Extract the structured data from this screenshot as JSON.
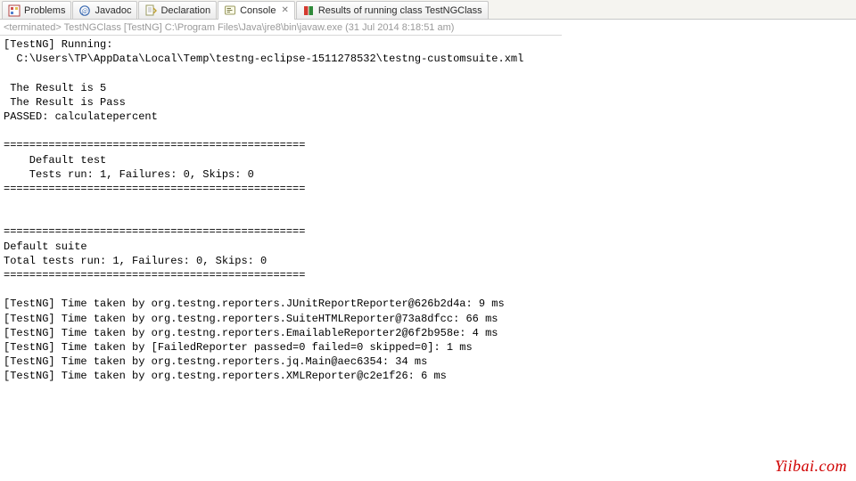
{
  "tabs": [
    {
      "label": "Problems"
    },
    {
      "label": "Javadoc"
    },
    {
      "label": "Declaration"
    },
    {
      "label": "Console"
    },
    {
      "label": "Results of running class TestNGClass"
    }
  ],
  "status": {
    "terminated": "<terminated>",
    "rest": " TestNGClass [TestNG] C:\\Program Files\\Java\\jre8\\bin\\javaw.exe (31 Jul 2014 8:18:51 am)"
  },
  "console_output": "[TestNG] Running:\n  C:\\Users\\TP\\AppData\\Local\\Temp\\testng-eclipse-1511278532\\testng-customsuite.xml\n\n The Result is 5\n The Result is Pass\nPASSED: calculatepercent\n\n===============================================\n    Default test\n    Tests run: 1, Failures: 0, Skips: 0\n===============================================\n\n\n===============================================\nDefault suite\nTotal tests run: 1, Failures: 0, Skips: 0\n===============================================\n\n[TestNG] Time taken by org.testng.reporters.JUnitReportReporter@626b2d4a: 9 ms\n[TestNG] Time taken by org.testng.reporters.SuiteHTMLReporter@73a8dfcc: 66 ms\n[TestNG] Time taken by org.testng.reporters.EmailableReporter2@6f2b958e: 4 ms\n[TestNG] Time taken by [FailedReporter passed=0 failed=0 skipped=0]: 1 ms\n[TestNG] Time taken by org.testng.reporters.jq.Main@aec6354: 34 ms\n[TestNG] Time taken by org.testng.reporters.XMLReporter@c2e1f26: 6 ms",
  "watermark": "Yiibai.com"
}
